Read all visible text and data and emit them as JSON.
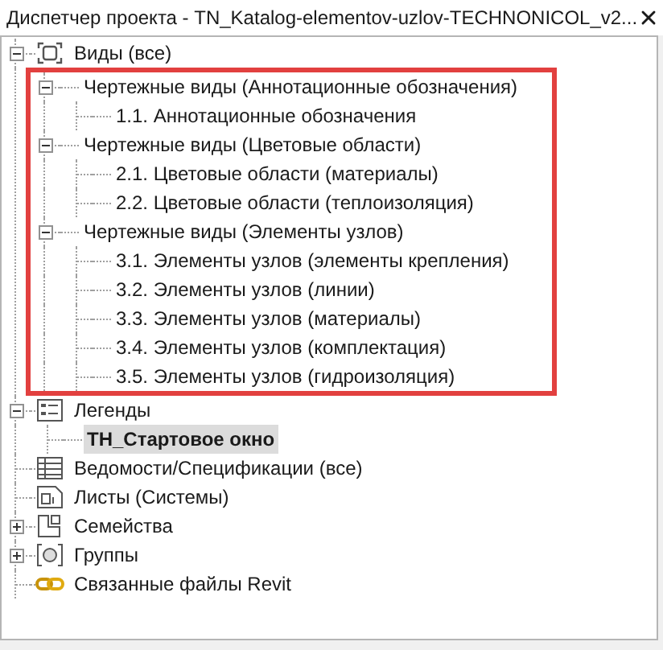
{
  "window": {
    "title": "Диспетчер проекта - TN_Katalog-elementov-uzlov-TECHNONICOL_v2..."
  },
  "tree": [
    {
      "label": "Виды (все)",
      "kind": "views",
      "expanded": true,
      "selected": false,
      "children_highlighted": true,
      "children": [
        {
          "label": "Чертежные виды (Аннотационные обозначения)",
          "expanded": true,
          "selected": false,
          "children": [
            {
              "label": "1.1. Аннотационные обозначения",
              "selected": false
            }
          ]
        },
        {
          "label": "Чертежные виды (Цветовые области)",
          "expanded": true,
          "selected": false,
          "children": [
            {
              "label": "2.1. Цветовые области (материалы)",
              "selected": false
            },
            {
              "label": "2.2. Цветовые области (теплоизоляция)",
              "selected": false
            }
          ]
        },
        {
          "label": "Чертежные виды (Элементы узлов)",
          "expanded": true,
          "selected": false,
          "children": [
            {
              "label": "3.1. Элементы узлов (элементы крепления)",
              "selected": false
            },
            {
              "label": "3.2. Элементы узлов (линии)",
              "selected": false
            },
            {
              "label": "3.3. Элементы узлов (материалы)",
              "selected": false
            },
            {
              "label": "3.4. Элементы узлов (комплектация)",
              "selected": false
            },
            {
              "label": "3.5. Элементы узлов (гидроизоляция)",
              "selected": false
            }
          ]
        }
      ]
    },
    {
      "label": "Легенды",
      "kind": "legends",
      "expanded": true,
      "selected": false,
      "children": [
        {
          "label": "ТН_Стартовое окно",
          "selected": true
        }
      ]
    },
    {
      "label": "Ведомости/Спецификации (все)",
      "kind": "schedules",
      "selected": false
    },
    {
      "label": "Листы (Системы)",
      "kind": "sheets",
      "selected": false
    },
    {
      "label": "Семейства",
      "kind": "families",
      "expanded": false,
      "selected": false
    },
    {
      "label": "Группы",
      "kind": "groups",
      "expanded": false,
      "selected": false
    },
    {
      "label": "Связанные файлы Revit",
      "kind": "links",
      "selected": false
    }
  ]
}
